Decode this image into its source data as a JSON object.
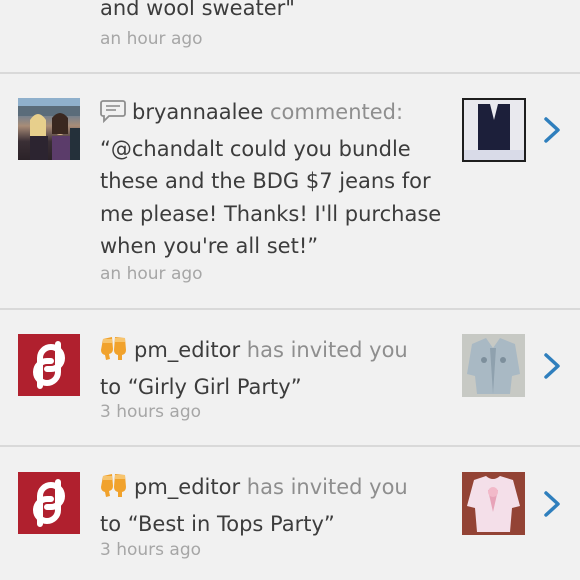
{
  "items": [
    {
      "text_tail": "and wool sweater\"",
      "time": "an hour ago"
    },
    {
      "username": "bryannaalee",
      "verb": "commented:",
      "line1": "“@chandalt could you bundle",
      "line2": "these and the BDG $7 jeans for",
      "line3": "me please! Thanks! I'll purchase",
      "line4": "when you're all set!”",
      "time": "an hour ago",
      "icon": "comment-bubble-icon"
    },
    {
      "username": "pm_editor",
      "verb": "has invited you",
      "line2": "to “Girly Girl Party”",
      "time": "3 hours ago",
      "icon": "party-glasses-icon"
    },
    {
      "username": "pm_editor",
      "verb": "has invited you",
      "line2": "to “Best in Tops Party”",
      "time": "3 hours ago",
      "icon": "party-glasses-icon"
    }
  ],
  "colors": {
    "chevron": "#2f7fbd",
    "brand_red": "#b0202e",
    "party_icon": "#f1a22c"
  }
}
